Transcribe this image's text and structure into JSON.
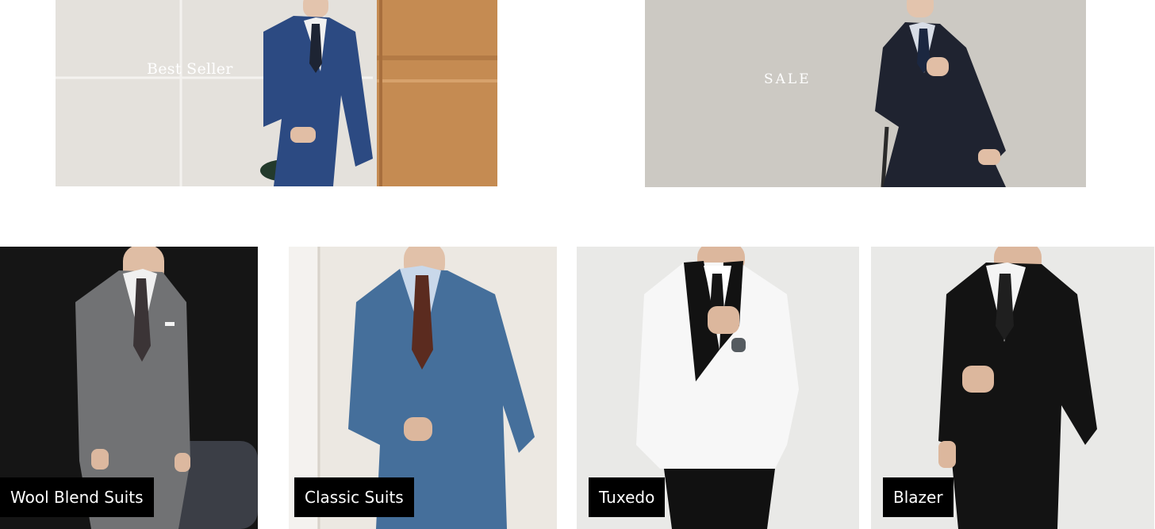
{
  "banners": {
    "best_seller": {
      "label": "Best Seller"
    },
    "sale": {
      "label": "SALE"
    }
  },
  "categories": [
    {
      "label": "Wool Blend Suits",
      "suit_color": "#6f7072",
      "tie_color": "#3a3436"
    },
    {
      "label": "Classic Suits",
      "suit_color": "#3f6a96",
      "tie_color": "#5a2a20"
    },
    {
      "label": "Tuxedo",
      "suit_color": "#f7f7f7",
      "tie_color": "#111111"
    },
    {
      "label": "Blazer",
      "suit_color": "#141414",
      "tie_color": "#1f1f1f"
    }
  ]
}
